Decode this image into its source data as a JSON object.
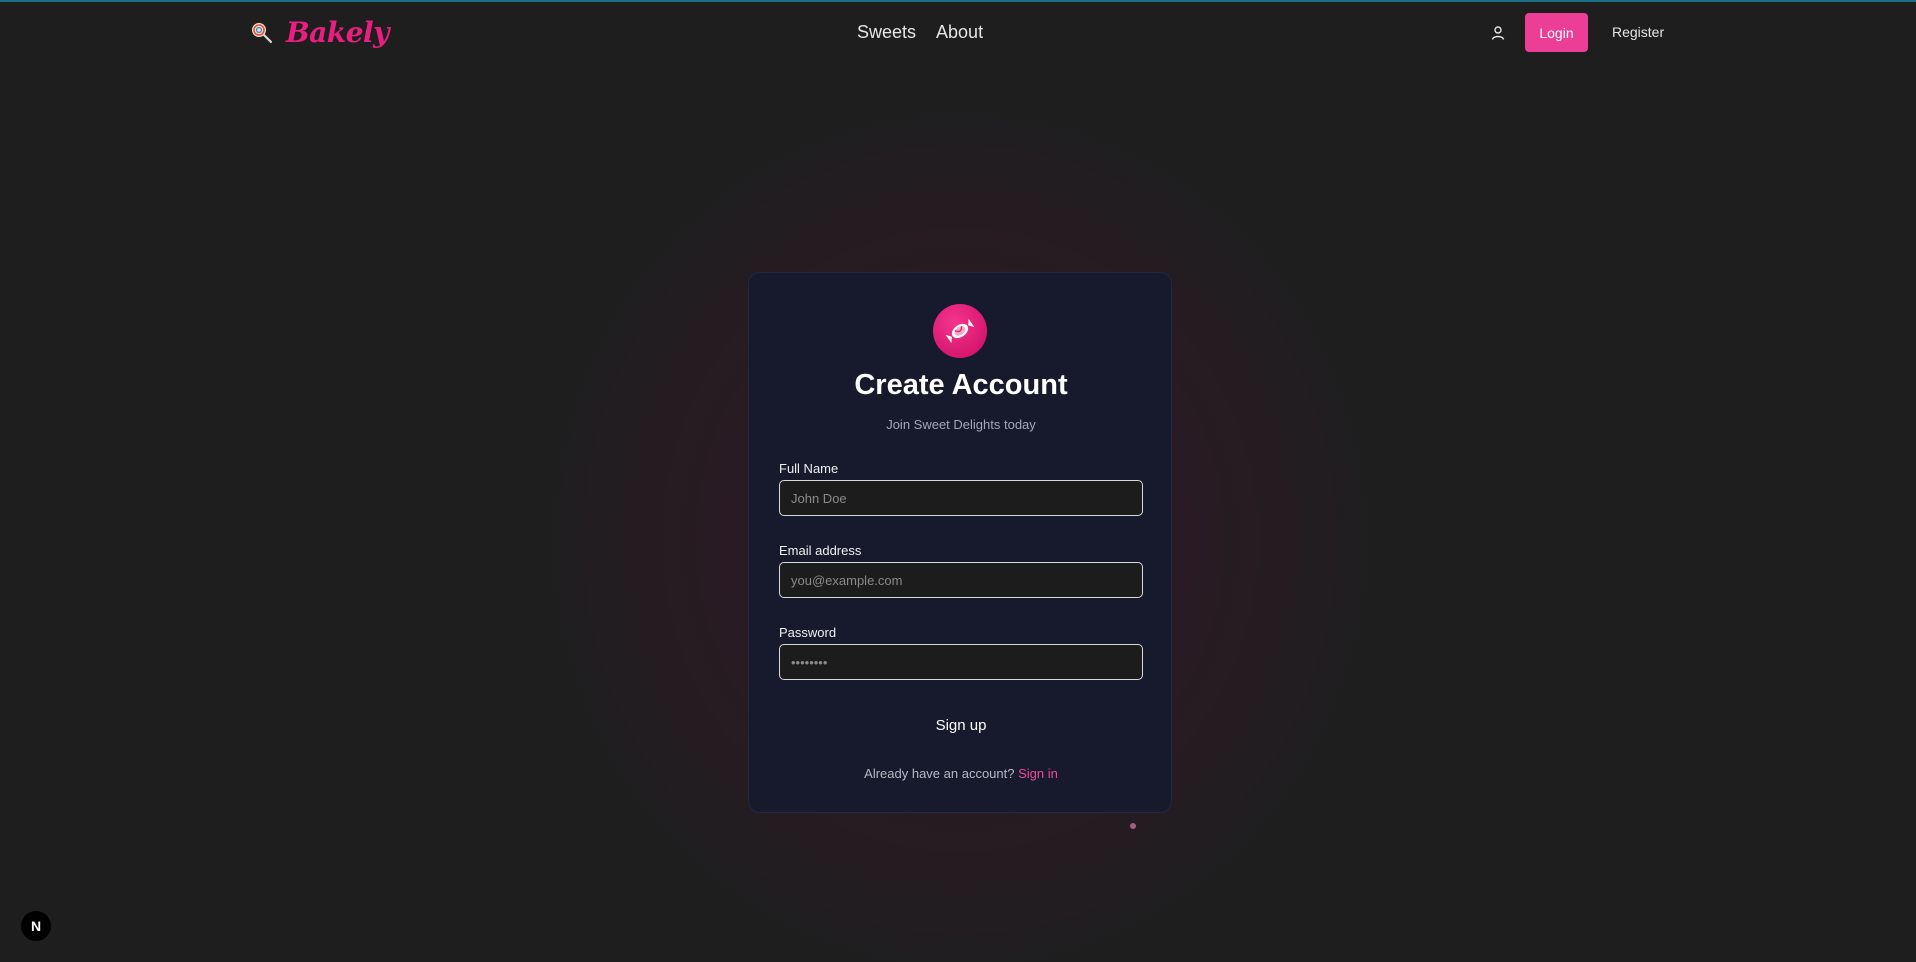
{
  "brand": {
    "name": "Bakely",
    "icon": "lollipop-icon"
  },
  "nav": {
    "links": [
      "Sweets",
      "About"
    ],
    "user_icon": "user-icon",
    "login_label": "Login",
    "register_label": "Register"
  },
  "card": {
    "logo_icon": "candy-icon",
    "title": "Create Account",
    "subtitle": "Join Sweet Delights today",
    "fields": {
      "full_name": {
        "label": "Full Name",
        "placeholder": "John Doe"
      },
      "email": {
        "label": "Email address",
        "placeholder": "you@example.com"
      },
      "password": {
        "label": "Password",
        "placeholder": "••••••••"
      }
    },
    "submit_label": "Sign up",
    "footer_text": "Already have an account? ",
    "footer_link": "Sign in"
  },
  "badge": {
    "label": "N"
  },
  "colors": {
    "accent": "#ec3d97",
    "brand": "#e91e80",
    "card_bg": "#161a2c",
    "page_bg": "#1e1e1f"
  }
}
